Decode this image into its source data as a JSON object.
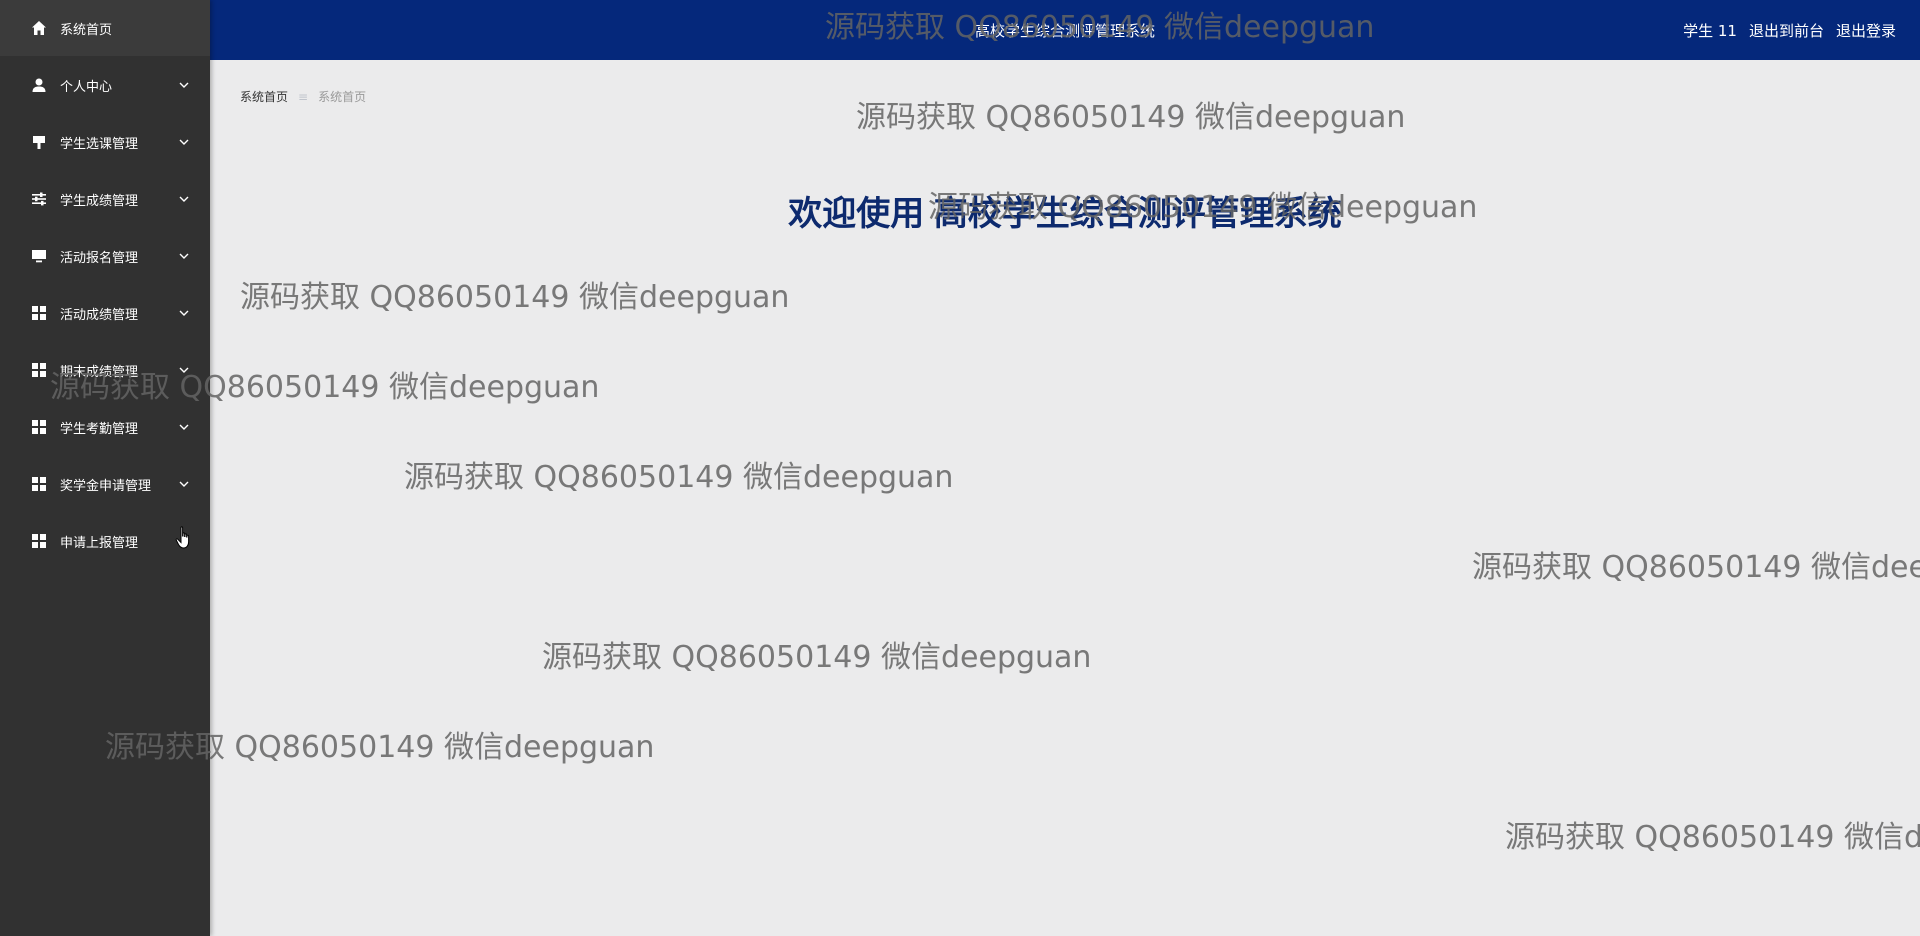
{
  "sidebar": {
    "items": [
      {
        "label": "系统首页",
        "icon": "home-icon",
        "has_chevron": false
      },
      {
        "label": "个人中心",
        "icon": "user-icon",
        "has_chevron": true
      },
      {
        "label": "学生选课管理",
        "icon": "flag-icon",
        "has_chevron": true
      },
      {
        "label": "学生成绩管理",
        "icon": "sliders-icon",
        "has_chevron": true
      },
      {
        "label": "活动报名管理",
        "icon": "monitor-icon",
        "has_chevron": true
      },
      {
        "label": "活动成绩管理",
        "icon": "grid-icon",
        "has_chevron": true
      },
      {
        "label": "期末成绩管理",
        "icon": "grid-icon",
        "has_chevron": true
      },
      {
        "label": "学生考勤管理",
        "icon": "grid-icon",
        "has_chevron": true
      },
      {
        "label": "奖学金申请管理",
        "icon": "grid-icon",
        "has_chevron": true
      },
      {
        "label": "申请上报管理",
        "icon": "grid-icon",
        "has_chevron": false
      }
    ]
  },
  "header": {
    "title": "高校学生综合测评管理系统",
    "user": "学生 11",
    "to_front": "退出到前台",
    "logout": "退出登录"
  },
  "breadcrumb": {
    "home": "系统首页",
    "separator": "≡",
    "current": "系统首页"
  },
  "main": {
    "welcome": "欢迎使用 高校学生综合测评管理系统"
  },
  "watermark": {
    "text": "源码获取 QQ86050149 微信deepguan"
  },
  "colors": {
    "sidebar_bg": "#313131",
    "header_bg": "#05287b",
    "content_bg": "#ebebec",
    "welcome_text": "#0d2a6e"
  }
}
